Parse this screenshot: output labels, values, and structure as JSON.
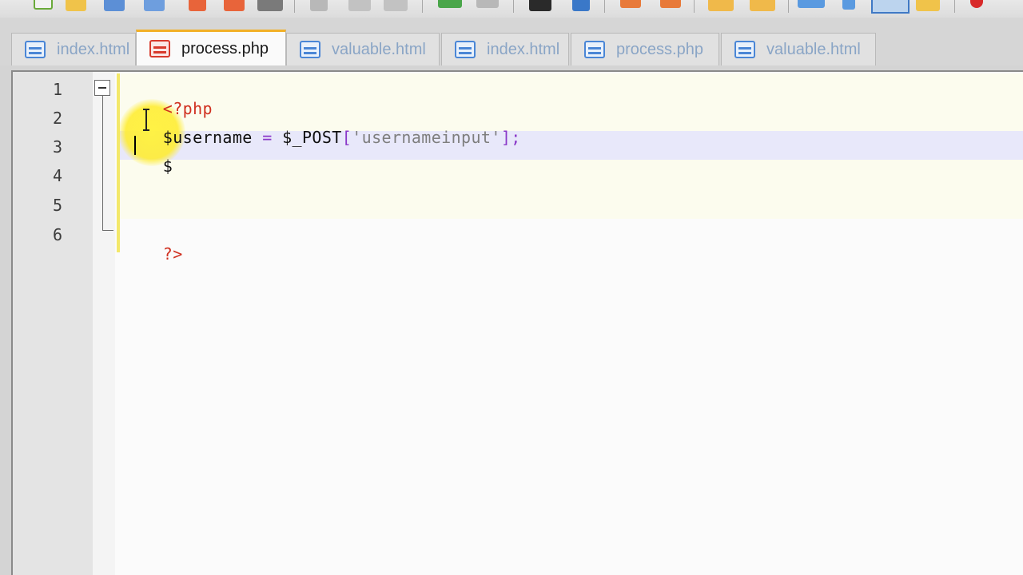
{
  "tabs": [
    {
      "label": "index.html",
      "active": false
    },
    {
      "label": "process.php",
      "active": true
    },
    {
      "label": "valuable.html",
      "active": false
    },
    {
      "label": "index.html",
      "active": false
    },
    {
      "label": "process.php",
      "active": false
    },
    {
      "label": "valuable.html",
      "active": false
    }
  ],
  "editor": {
    "line_numbers": [
      "1",
      "2",
      "3",
      "4",
      "5",
      "6"
    ],
    "lines": {
      "l1_open_tag": "<?php",
      "l2_var": "$username",
      "l2_eq": " = ",
      "l2_post": "$_POST",
      "l2_bracket_open": "[",
      "l2_string": "'usernameinput'",
      "l2_bracket_close": "];",
      "l3_text": "$",
      "l6_close_tag": "?>"
    }
  },
  "colors": {
    "active_tab_accent": "#f2b027",
    "php_tag": "#d03020",
    "operator": "#8a38c8",
    "string": "#7e7e7e",
    "cursor_highlight": "#ffec28"
  },
  "icons": [
    "new-file-icon",
    "open-folder-icon",
    "save-icon",
    "save-all-icon",
    "close-icon",
    "close-all-icon",
    "print-icon",
    "cut-icon",
    "copy-icon",
    "paste-icon",
    "undo-icon",
    "redo-icon",
    "find-icon",
    "replace-icon",
    "zoom-in-icon",
    "zoom-out-icon",
    "word-wrap-icon",
    "record-macro-icon"
  ]
}
